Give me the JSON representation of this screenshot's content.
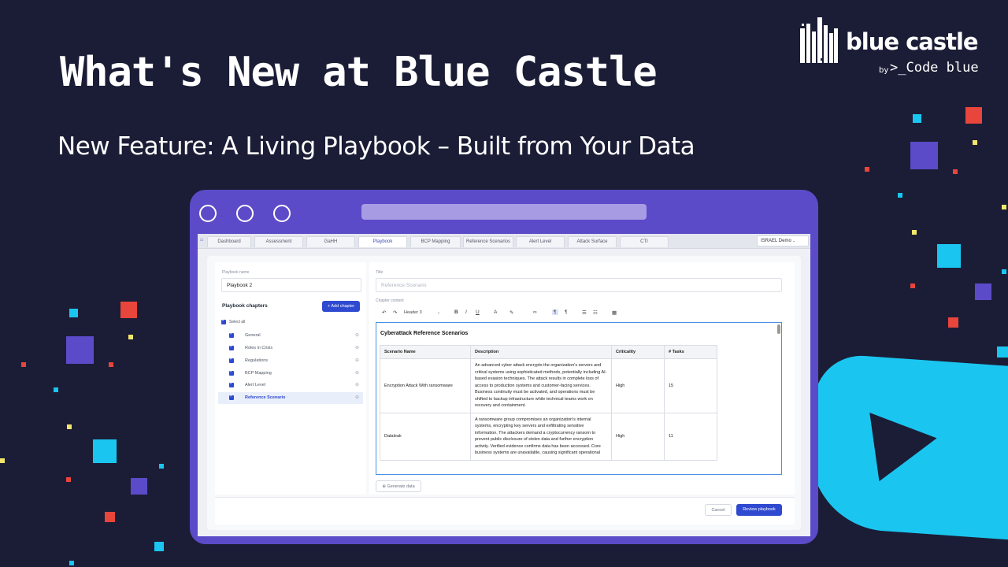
{
  "headline": "What's New at Blue Castle",
  "subheadline": "New Feature: A Living Playbook – Built from Your Data",
  "brand": {
    "name": "blue castle",
    "by": "by",
    "company": ">_Code blue"
  },
  "app": {
    "tabs": [
      "Dashboard",
      "Assessment",
      "GaHH",
      "Playbook",
      "BCP Mapping",
      "Reference Scenarios",
      "Alert Level",
      "Attack Surface",
      "CTI"
    ],
    "active_tab": "Playbook",
    "user": "ISRAEL Demo ..",
    "playbook_name_label": "Playbook name",
    "playbook_name": "Playbook 2",
    "chapters_title": "Playbook chapters",
    "add_chapter": "+ Add chapter",
    "select_all": "Select all",
    "chapters": [
      "General",
      "Roles in Crisis",
      "Regulations",
      "BCP Mapping",
      "Alert Level",
      "Reference Scenario"
    ],
    "selected_chapter": "Reference Scenario",
    "title_label": "Title",
    "title_placeholder": "Reference Scenario",
    "content_label": "Chapter content",
    "heading_select": "Header 3",
    "editor_title": "Cyberattack Reference Scenarios",
    "table_headers": [
      "Scenario Name",
      "Description",
      "Criticality",
      "# Tasks"
    ],
    "rows": [
      {
        "name": "Encryption Attack With ransomware",
        "description": "An advanced cyber attack encrypts the organization's servers and critical systems using sophisticated methods, potentially including AI-based evasion techniques. The attack results in complete loss of access to production systems and customer-facing services. Business continuity must be activated, and operations must be shifted to backup infrastructure while technical teams work on recovery and containment.",
        "criticality": "High",
        "tasks": "15"
      },
      {
        "name": "Dataleak",
        "description": "A ransomware group compromises an organization's internal systems, encrypting key servers and exfiltrating sensitive information. The attackers demand a cryptocurrency ransom to prevent public disclosure of stolen data and further encryption activity. Verified evidence confirms data has been accessed. Core business systems are unavailable, causing significant operational",
        "criticality": "High",
        "tasks": "11"
      }
    ],
    "generate_data": "Generate data",
    "cancel": "Cancel",
    "review": "Review playbook"
  },
  "colors": {
    "background": "#1b1d36",
    "frame": "#5b4bc8",
    "accent_cyan": "#1ac6f0",
    "accent_red": "#e8453c",
    "accent_purple": "#5b4bc8",
    "primary_button": "#2f4ad0"
  }
}
